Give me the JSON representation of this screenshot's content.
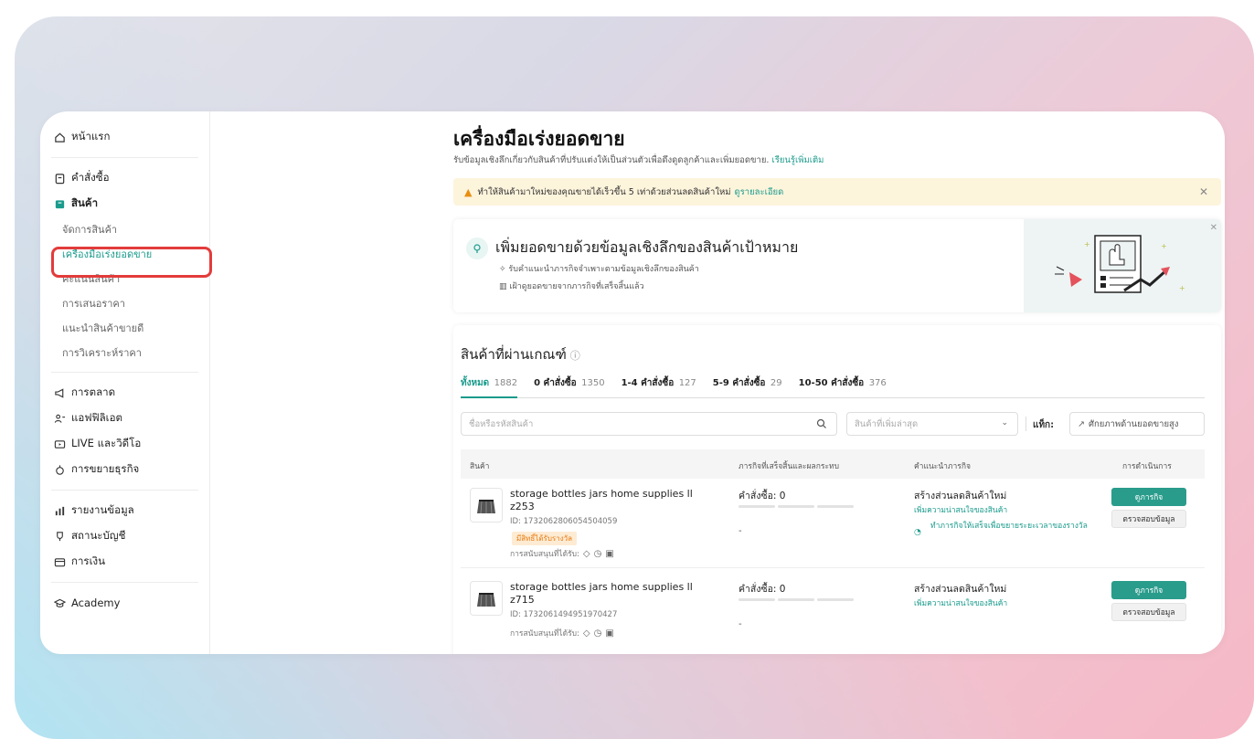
{
  "sidebar": {
    "home": "หน้าแรก",
    "orders": "คำสั่งซื้อ",
    "products": "สินค้า",
    "product_sub": [
      "จัดการสินค้า",
      "เครื่องมือเร่งยอดขาย",
      "คะแนนสินค้า",
      "การเสนอราคา",
      "แนะนำสินค้าขายดี",
      "การวิเคราะห์ราคา"
    ],
    "marketing": "การตลาด",
    "affiliate": "แอฟฟิลิเอต",
    "live": "LIVE และวิดีโอ",
    "growth": "การขยายธุรกิจ",
    "data": "รายงานข้อมูล",
    "account": "สถานะบัญชี",
    "finance": "การเงิน",
    "academy": "Academy"
  },
  "header": {
    "title": "เครื่องมือเร่งยอดขาย",
    "subtitle": "รับข้อมูลเชิงลึกเกี่ยวกับสินค้าที่ปรับแต่งให้เป็นส่วนตัวเพื่อดึงดูดลูกค้าและเพิ่มยอดขาย.",
    "learn_more": "เรียนรู้เพิ่มเติม"
  },
  "alert": {
    "text": "ทำให้สินค้ามาใหม่ของคุณขายได้เร็วขึ้น 5 เท่าด้วยส่วนลดสินค้าใหม่",
    "link": "ดูรายละเอียด"
  },
  "banner": {
    "title": "เพิ่มยอดขายด้วยข้อมูลเชิงลึกของสินค้าเป้าหมาย",
    "line1": "รับคำแนะนำภารกิจจำเพาะตามข้อมูลเชิงลึกของสินค้า",
    "line2": "เฝ้าดูยอดขายจากภารกิจที่เสร็จสิ้นแล้ว"
  },
  "card": {
    "title": "สินค้าที่ผ่านเกณฑ์",
    "tabs": [
      {
        "label": "ทั้งหมด",
        "count": "1882"
      },
      {
        "label": "0 คำสั่งซื้อ",
        "count": "1350"
      },
      {
        "label": "1-4 คำสั่งซื้อ",
        "count": "127"
      },
      {
        "label": "5-9 คำสั่งซื้อ",
        "count": "29"
      },
      {
        "label": "10-50 คำสั่งซื้อ",
        "count": "376"
      }
    ],
    "search_placeholder": "ชื่อหรือรหัสสินค้า",
    "sort_placeholder": "สินค้าที่เพิ่มล่าสุด",
    "tag_label": "แท็ก:",
    "tag_value": "ศักยภาพด้านยอดขายสูง",
    "columns": [
      "สินค้า",
      "ภารกิจที่เสร็จสิ้นและผลกระทบ",
      "คำแนะนำภารกิจ",
      "การดำเนินการ"
    ],
    "rows": [
      {
        "name": "storage bottles jars home supplies ll z253",
        "id": "ID: 1732062806054504059",
        "badge": "มีสิทธิ์ได้รับรางวัล",
        "support": "การสนับสนุนที่ได้รับ:",
        "orders": "คำสั่งซื้อ: 0",
        "impact": "-",
        "rec_title": "สร้างส่วนลดสินค้าใหม่",
        "rec_sub": "เพิ่มความน่าสนใจของสินค้า",
        "rec_task": "ทำภารกิจให้เสร็จเพื่อขยายระยะเวลาของรางวัล",
        "btn_go": "ดูภารกิจ",
        "btn_check": "ตรวจสอบข้อมูล"
      },
      {
        "name": "storage bottles jars home supplies ll z715",
        "id": "ID: 1732061494951970427",
        "support": "การสนับสนุนที่ได้รับ:",
        "orders": "คำสั่งซื้อ: 0",
        "impact": "-",
        "rec_title": "สร้างส่วนลดสินค้าใหม่",
        "rec_sub": "เพิ่มความน่าสนใจของสินค้า",
        "btn_go": "ดูภารกิจ",
        "btn_check": "ตรวจสอบข้อมูล"
      }
    ]
  },
  "colors": {
    "accent": "#1a9b8c",
    "highlight": "#e33b3b",
    "alert_bg": "#fdf4dc"
  }
}
